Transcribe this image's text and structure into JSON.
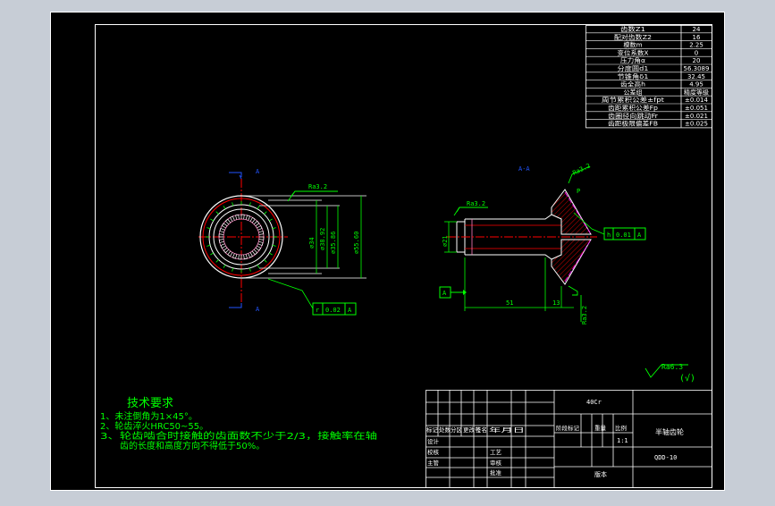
{
  "colors": {
    "background": "#000000",
    "outer_frame": "#ffffff",
    "viewport_bg": "#c7cdd6",
    "green": "#00ff00",
    "red": "#ff0000",
    "cyan": "#00ffff",
    "blue": "#2255ff",
    "white": "#ffffff",
    "pink": "#ff7fbf",
    "magenta": "#ff00ff"
  },
  "param_table": {
    "rows": [
      {
        "label": "齿数Z1",
        "value": "24"
      },
      {
        "label": "配对齿数Z2",
        "value": "16"
      },
      {
        "label": "模数m",
        "value": "2.25"
      },
      {
        "label": "变位系数X",
        "value": "0"
      },
      {
        "label": "压力角α",
        "value": "20"
      },
      {
        "label": "分度圆d1",
        "value": "56.3089"
      },
      {
        "label": "节锥角δ1",
        "value": "32.45"
      },
      {
        "label": "齿全高h",
        "value": "4.95"
      },
      {
        "label": "公差组",
        "value": "精度等级"
      },
      {
        "label": "周节累积公差±fpt",
        "value": "±0.014"
      },
      {
        "label": "齿距累积公差Fp",
        "value": "±0.051"
      },
      {
        "label": "齿圈径向跳动Fr",
        "value": "±0.021"
      },
      {
        "label": "齿距极限偏差FΒ",
        "value": "±0.025"
      }
    ]
  },
  "front_view": {
    "section_label_top": "A",
    "section_label_bottom": "A",
    "roughness": "Ra3.2",
    "dim_labels": [
      "⌀38.92",
      "⌀35.86",
      "⌀34",
      "⌀55.60"
    ],
    "tolerance": {
      "symbol": "r",
      "value": "0.02",
      "datum": "A"
    }
  },
  "section_view": {
    "title": "A-A",
    "roughness_top_left": "Ra3.2",
    "roughness_bevel": "Ra3.2",
    "roughness_bottom": "Ra3.2",
    "dim_shaft_dia": "⌀21",
    "dim_length": "51",
    "dim_step": "13",
    "tolerance": {
      "symbol": "h",
      "value": "0.01",
      "datum": "A"
    },
    "datum_label": "A"
  },
  "overall_roughness": {
    "label": "Ra6.3",
    "suffix": "(√)"
  },
  "tech_requirements": {
    "title": "技术要求",
    "lines": [
      "1、未注倒角为1×45°。",
      "2、轮齿淬火HRC50~55。",
      "3、轮齿啮合时接触的齿面数不少于2/3，接触率在轴",
      "齿的长度和高度方向不得低于50%。"
    ]
  },
  "title_block": {
    "material": "40Cr",
    "part_name": "半轴齿轮",
    "drawing_no": "QDD-10",
    "scale": "1:1",
    "header_row": [
      "标记",
      "处数",
      "分区",
      "更改号",
      "签名",
      "年月日"
    ],
    "stage_labels": [
      "阶段标记",
      "重量",
      "比例"
    ],
    "left_labels": [
      "设计",
      "校核",
      "主管"
    ],
    "mid_labels": [
      "工艺",
      "审核",
      "批准"
    ],
    "version_label": "版本"
  }
}
